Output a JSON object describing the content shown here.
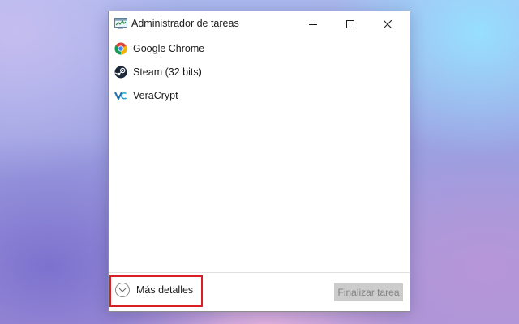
{
  "window": {
    "title": "Administrador de tareas",
    "icon": "task-manager-icon",
    "controls": [
      "minimize-icon",
      "maximize-icon",
      "close-icon"
    ]
  },
  "apps": [
    {
      "label": "Google Chrome",
      "icon": "chrome-icon"
    },
    {
      "label": "Steam (32 bits)",
      "icon": "steam-icon"
    },
    {
      "label": "VeraCrypt",
      "icon": "veracrypt-icon"
    }
  ],
  "footer": {
    "more_details_label": "Más detalles",
    "more_details_icon": "chevron-down-icon",
    "end_task_label": "Finalizar tarea",
    "end_task_enabled": false
  },
  "annotation": {
    "highlight_color": "#d81f26"
  }
}
